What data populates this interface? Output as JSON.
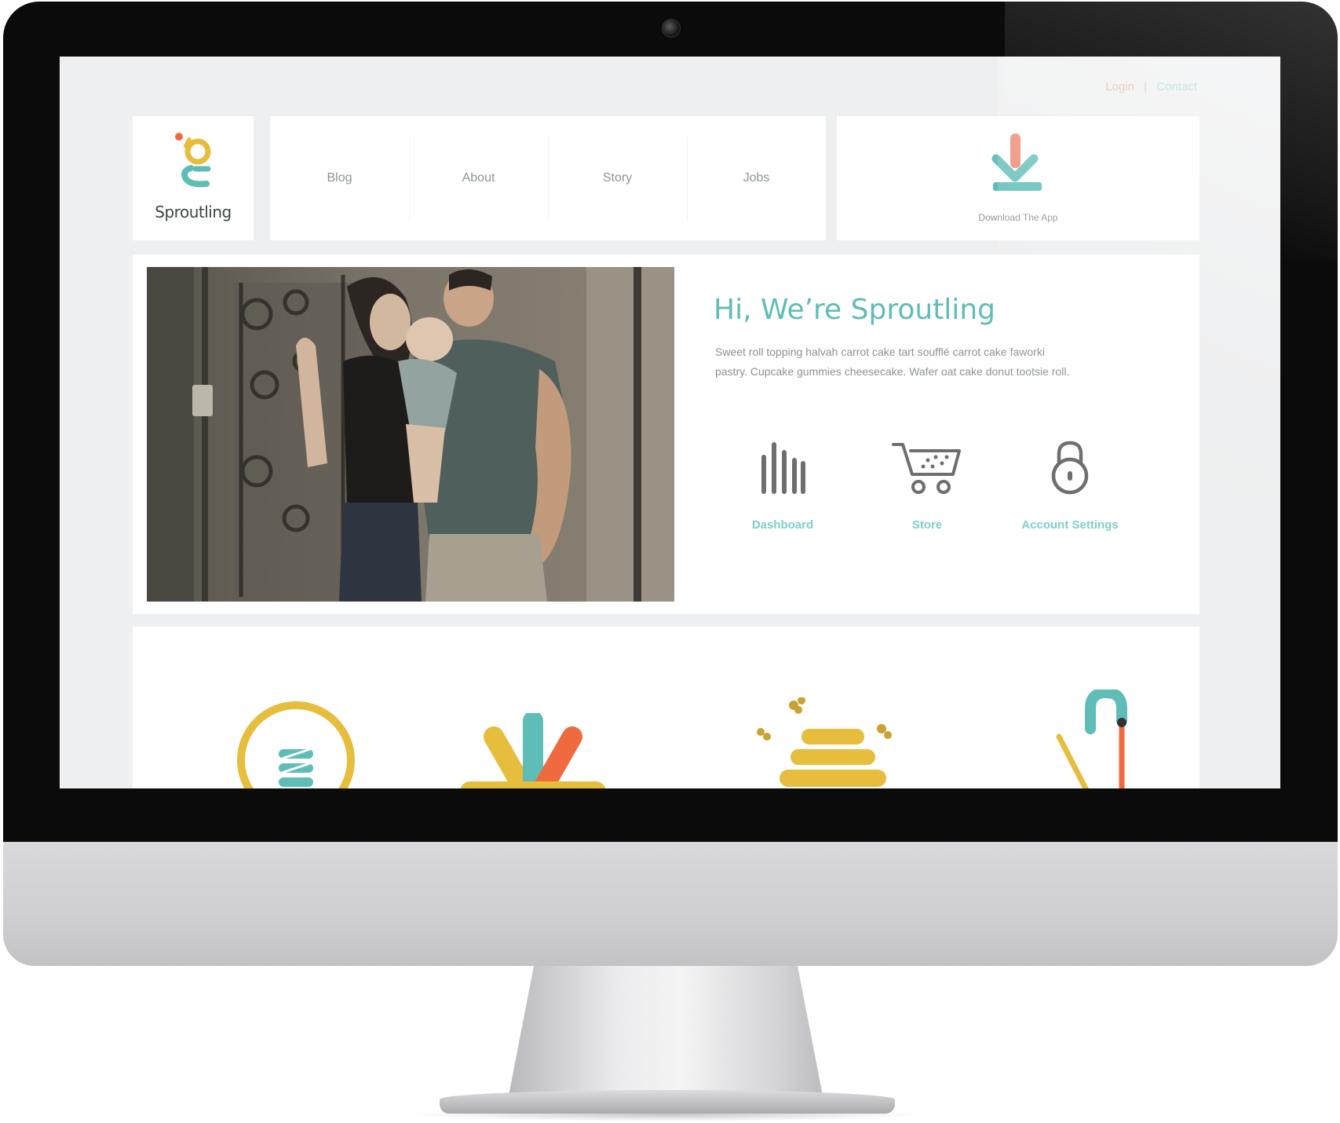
{
  "header": {
    "login_label": "Login",
    "separator": "|",
    "contact_label": "Contact"
  },
  "brand": {
    "name": "Sproutling"
  },
  "nav": {
    "items": [
      {
        "label": "Blog"
      },
      {
        "label": "About"
      },
      {
        "label": "Story"
      },
      {
        "label": "Jobs"
      }
    ]
  },
  "download": {
    "label": "Download The App"
  },
  "hero": {
    "title": "Hi, We’re Sproutling",
    "body": "Sweet roll topping halvah carrot cake tart soufflé carrot cake faworki pastry. Cupcake gummies cheesecake. Wafer oat cake donut tootsie roll.",
    "actions": [
      {
        "label": "Dashboard",
        "icon": "bars-icon"
      },
      {
        "label": "Store",
        "icon": "cart-icon"
      },
      {
        "label": "Account Settings",
        "icon": "lock-icon"
      }
    ]
  },
  "colors": {
    "teal": "#5fbdb7",
    "mustard": "#e6bd3c",
    "orange": "#ef6a3e",
    "coral": "#ee8a73",
    "text_gray": "#8c9295"
  }
}
